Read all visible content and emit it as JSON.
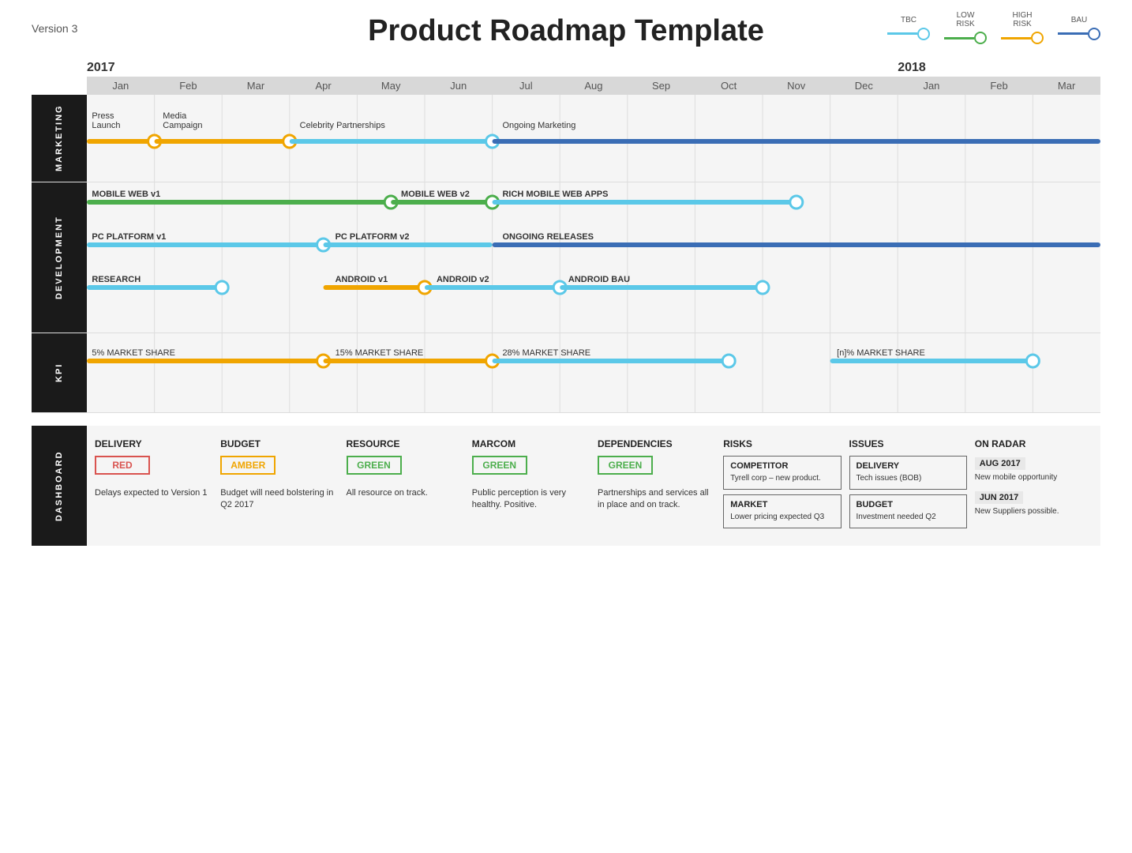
{
  "header": {
    "version": "Version 3",
    "title": "Product Roadmap Template"
  },
  "legend": {
    "items": [
      {
        "label": "TBC",
        "color": "#5bc8e8",
        "line_color": "#5bc8e8"
      },
      {
        "label": "LOW\nRISK",
        "color": "#4cae4c",
        "line_color": "#4cae4c"
      },
      {
        "label": "HIGH\nRISK",
        "color": "#f0a500",
        "line_color": "#f0a500"
      },
      {
        "label": "BAU",
        "color": "#3a6db5",
        "line_color": "#3a6db5"
      }
    ]
  },
  "timeline": {
    "years": [
      {
        "label": "2017",
        "col_start": 0,
        "col_span": 12
      },
      {
        "label": "2018",
        "col_start": 12,
        "col_span": 3
      }
    ],
    "months": [
      "Jan",
      "Feb",
      "Mar",
      "Apr",
      "May",
      "Jun",
      "Jul",
      "Aug",
      "Sep",
      "Oct",
      "Nov",
      "Dec",
      "Jan",
      "Feb",
      "Mar"
    ]
  },
  "sections": {
    "marketing": {
      "label": "MARKETING",
      "bars": [
        {
          "label": "Press\nLaunch",
          "start": 0,
          "end": 1,
          "color": "#f0a500",
          "milestones": [
            1
          ]
        },
        {
          "label": "Media\nCampaign",
          "start": 1,
          "end": 3,
          "color": "#f0a500",
          "milestones": [
            3
          ]
        },
        {
          "label": "Celebrity Partnerships",
          "start": 3,
          "end": 6,
          "color": "#5bc8e8",
          "milestones": [
            6
          ]
        },
        {
          "label": "Ongoing Marketing",
          "start": 6,
          "end": 15,
          "color": "#3a6db5",
          "milestones": []
        }
      ]
    },
    "development": {
      "label": "DEVELOPMENT",
      "bars": [
        {
          "label": "MOBILE WEB v1",
          "start": 0,
          "end": 4.5,
          "color": "#4cae4c",
          "milestones": [
            4.5
          ]
        },
        {
          "label": "MOBILE WEB v2",
          "start": 4.5,
          "end": 6,
          "color": "#4cae4c",
          "milestones": [
            6
          ]
        },
        {
          "label": "RICH MOBILE WEB APPS",
          "start": 6,
          "end": 10.5,
          "color": "#5bc8e8",
          "milestones": [
            10.5
          ]
        },
        {
          "label": "PC PLATFORM v1",
          "start": 0,
          "end": 3.5,
          "color": "#5bc8e8",
          "milestones": [
            3.5
          ]
        },
        {
          "label": "PC PLATFORM v2",
          "start": 3.5,
          "end": 6,
          "color": "#5bc8e8",
          "milestones": []
        },
        {
          "label": "ONGOING RELEASES",
          "start": 6,
          "end": 15,
          "color": "#3a6db5",
          "milestones": []
        },
        {
          "label": "RESEARCH",
          "start": 0,
          "end": 2,
          "color": "#5bc8e8",
          "milestones": [
            2
          ]
        },
        {
          "label": "ANDROID v1",
          "start": 3.5,
          "end": 5,
          "color": "#f0a500",
          "milestones": [
            5
          ]
        },
        {
          "label": "ANDROID v2",
          "start": 5,
          "end": 7,
          "color": "#5bc8e8",
          "milestones": [
            7
          ]
        },
        {
          "label": "ANDROID BAU",
          "start": 7,
          "end": 10,
          "color": "#5bc8e8",
          "milestones": [
            10
          ]
        }
      ]
    },
    "kpi": {
      "label": "KPI",
      "bars": [
        {
          "label": "5% MARKET SHARE",
          "start": 0,
          "end": 3.5,
          "color": "#f0a500",
          "milestones": [
            3.5
          ]
        },
        {
          "label": "15% MARKET SHARE",
          "start": 3.5,
          "end": 6,
          "color": "#f0a500",
          "milestones": [
            6
          ]
        },
        {
          "label": "28% MARKET SHARE",
          "start": 6,
          "end": 9.5,
          "color": "#5bc8e8",
          "milestones": [
            9.5
          ]
        },
        {
          "label": "[n]% MARKET SHARE",
          "start": 11,
          "end": 14,
          "color": "#5bc8e8",
          "milestones": [
            14
          ]
        }
      ]
    }
  },
  "dashboard": {
    "columns": [
      {
        "title": "DELIVERY",
        "status": {
          "label": "RED",
          "color": "#d9534f",
          "border": "#d9534f"
        },
        "text": "Delays expected to Version 1"
      },
      {
        "title": "BUDGET",
        "status": {
          "label": "AMBER",
          "color": "#f0a500",
          "border": "#f0a500"
        },
        "text": "Budget will need bolstering in Q2 2017"
      },
      {
        "title": "RESOURCE",
        "status": {
          "label": "GREEN",
          "color": "#4cae4c",
          "border": "#4cae4c"
        },
        "text": "All resource on track."
      },
      {
        "title": "MARCOM",
        "status": {
          "label": "GREEN",
          "color": "#4cae4c",
          "border": "#4cae4c"
        },
        "text": "Public perception is very healthy. Positive."
      },
      {
        "title": "DEPENDENCIES",
        "status": {
          "label": "GREEN",
          "color": "#4cae4c",
          "border": "#4cae4c"
        },
        "text": "Partnerships and services all in place and on track."
      },
      {
        "title": "RISKS",
        "boxes": [
          {
            "title": "COMPETITOR",
            "text": "Tyrell corp – new product."
          },
          {
            "title": "MARKET",
            "text": "Lower pricing expected Q3"
          }
        ]
      },
      {
        "title": "ISSUES",
        "boxes": [
          {
            "title": "DELIVERY",
            "text": "Tech issues (BOB)"
          },
          {
            "title": "BUDGET",
            "text": "Investment needed Q2"
          }
        ]
      },
      {
        "title": "ON RADAR",
        "radar": [
          {
            "date": "AUG 2017",
            "text": "New mobile opportunity"
          },
          {
            "date": "JUN 2017",
            "text": "New Suppliers possible."
          }
        ]
      }
    ]
  }
}
